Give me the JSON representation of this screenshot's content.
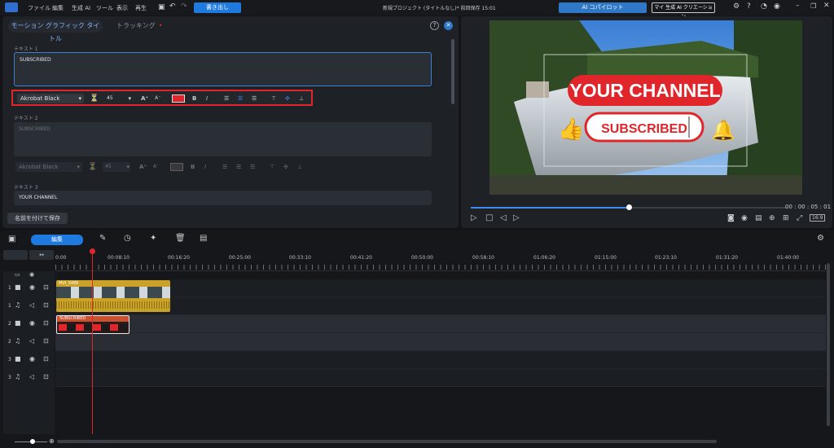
{
  "menubar": {
    "items": [
      "ファイル",
      "編集",
      "生成 AI",
      "ツール",
      "表示",
      "再生"
    ],
    "export_label": "書き出し",
    "project_title": "新規プロジェクト (タイトルなし)* 前回保存 15:01",
    "copilot_label": "AI コパイロット",
    "creation_label": "マイ 生成 AI クリエーション"
  },
  "editor": {
    "tabs": {
      "active": "モーション グラフィック タイトル",
      "inactive": "トラッキング"
    },
    "text1": {
      "label": "テキスト 1",
      "value": "SUBSCRIBED"
    },
    "text2": {
      "label": "テキスト 2",
      "value": "SUBSCRIBED"
    },
    "text3": {
      "label": "テキスト 3",
      "value": "YOUR CHANNEL"
    },
    "font_name": "Akrobat Black",
    "font_size": "45",
    "save_as_label": "名前を付けて保存",
    "highlight_color": "#e0262b",
    "text_color_swatch": "#e0262b"
  },
  "preview": {
    "overlay_top": "YOUR CHANNEL",
    "overlay_button": "SUBSCRIBED",
    "timecode": "00 : 00 : 05 : 01",
    "aspect": "16:9",
    "progress_fraction": 0.5
  },
  "timeline": {
    "edit_label": "編集",
    "ruler": [
      "0:00",
      "00:08:10",
      "00:16:20",
      "00:25:00",
      "00:33:10",
      "00:41:20",
      "00:50:00",
      "00:58:10",
      "01:06:20",
      "01:15:00",
      "01:23:10",
      "01:31:20",
      "01:40:00"
    ],
    "tracks": [
      "1",
      "1",
      "2",
      "2",
      "3",
      "3"
    ],
    "clip_video": "MVI_5486",
    "clip_title": "SUBSCRIBED"
  },
  "colors": {
    "accent": "#1f7ae0",
    "playhead": "#e0262b",
    "title_red": "#e0262b",
    "clip_gold": "#c9a227"
  }
}
